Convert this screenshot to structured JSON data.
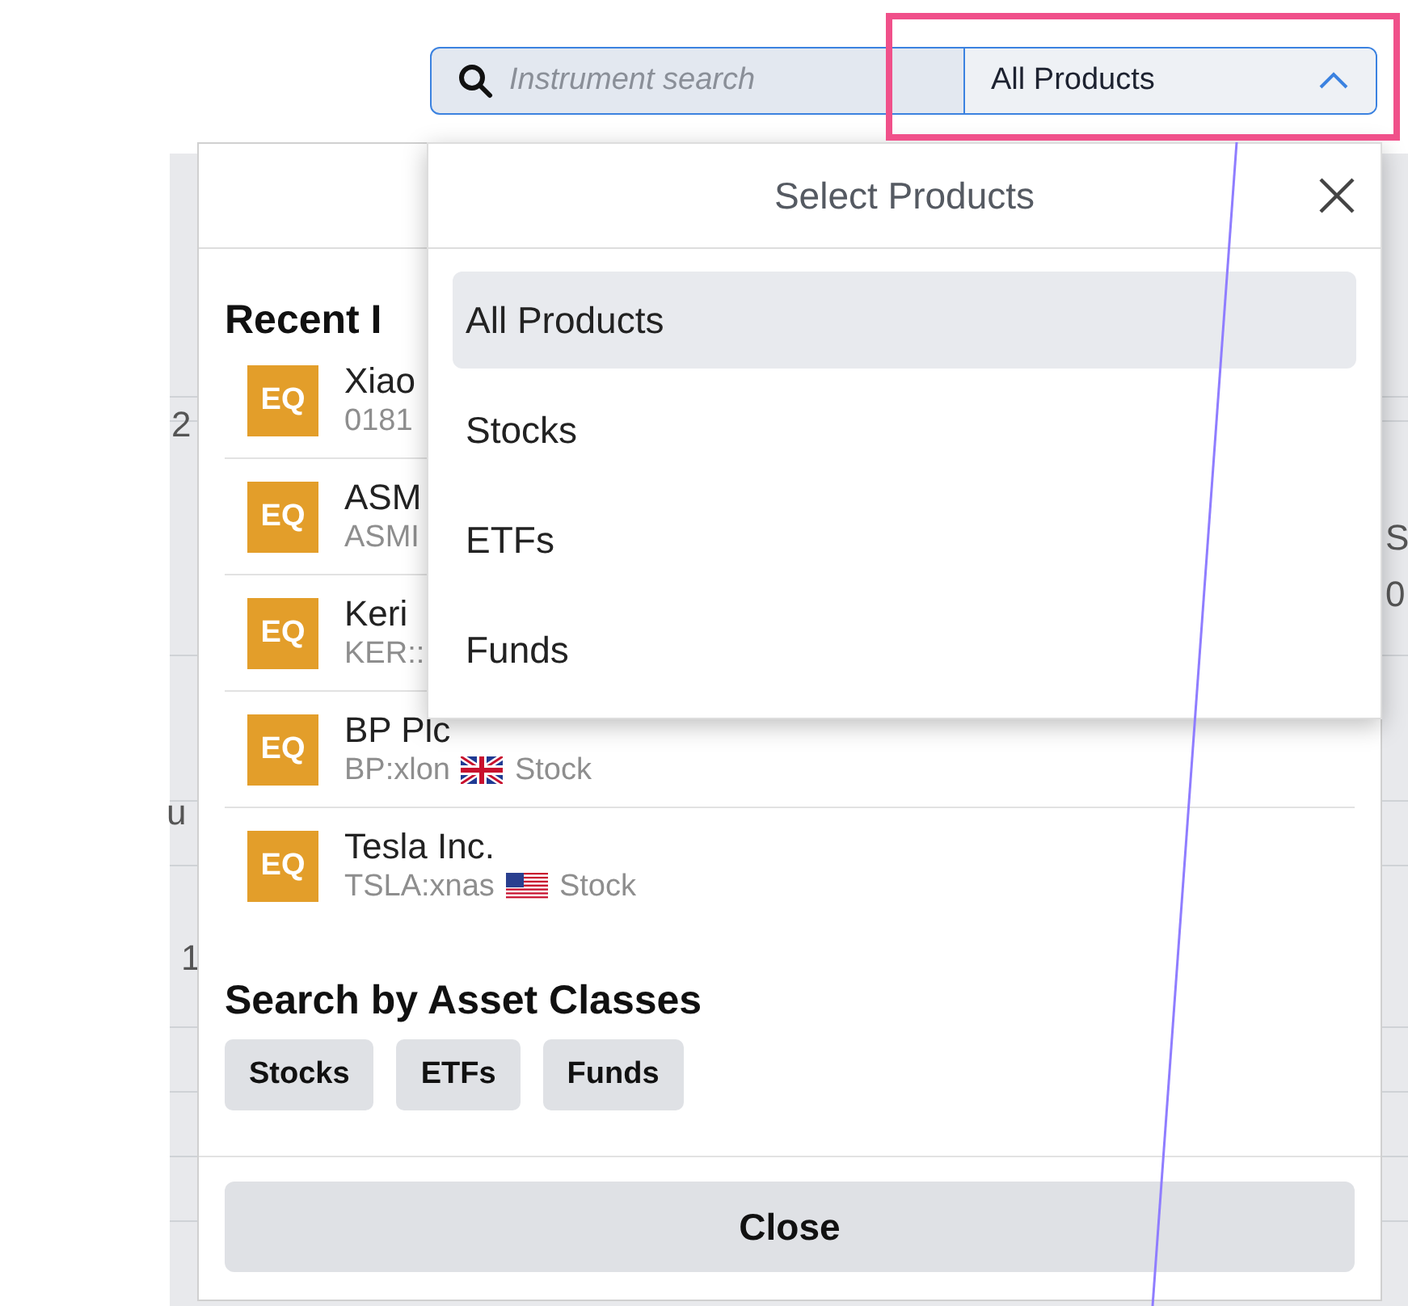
{
  "search": {
    "placeholder": "Instrument search",
    "product_select": "All Products",
    "expanded": true
  },
  "background_fragments": [
    {
      "text": "2"
    },
    {
      "text": "u"
    },
    {
      "text": "1"
    },
    {
      "text": "S"
    },
    {
      "text": "0"
    }
  ],
  "recent": {
    "heading": "Recent I",
    "items": [
      {
        "badge": "EQ",
        "name": "Xiao",
        "symbol": "0181"
      },
      {
        "badge": "EQ",
        "name": "ASM",
        "symbol": "ASMI"
      },
      {
        "badge": "EQ",
        "name": "Keri",
        "symbol": "KER::"
      },
      {
        "badge": "EQ",
        "name": "BP Plc",
        "symbol": "BP:xlon",
        "flag": {
          "kind": "uk"
        },
        "type": "Stock"
      },
      {
        "badge": "EQ",
        "name": "Tesla Inc.",
        "symbol": "TSLA:xnas",
        "flag": {
          "kind": "us"
        },
        "type": "Stock"
      }
    ]
  },
  "asset_classes": {
    "heading": "Search by Asset Classes",
    "chips": [
      "Stocks",
      "ETFs",
      "Funds"
    ]
  },
  "close_button": "Close",
  "dropdown": {
    "title": "Select Products",
    "options": [
      {
        "label": "All Products",
        "selected": true
      },
      {
        "label": "Stocks",
        "selected": false
      },
      {
        "label": "ETFs",
        "selected": false
      },
      {
        "label": "Funds",
        "selected": false
      }
    ]
  }
}
